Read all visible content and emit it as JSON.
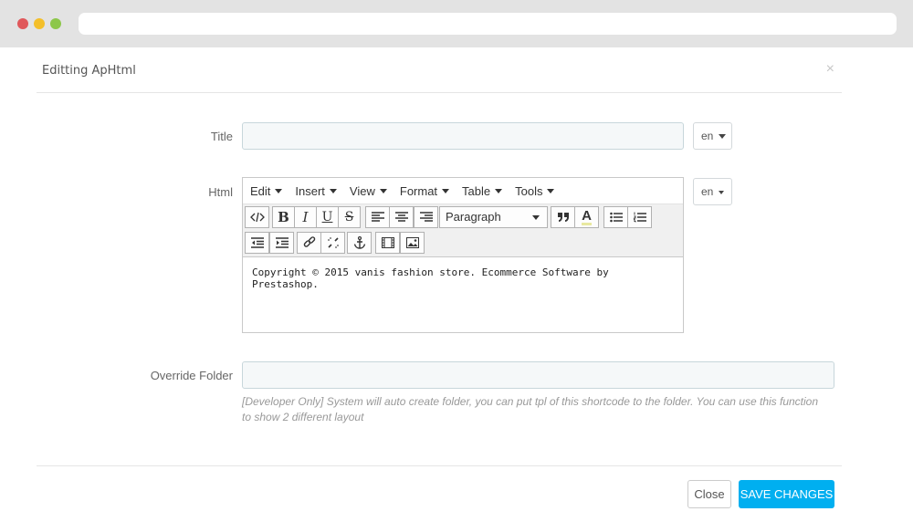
{
  "modal": {
    "title": "Editting ApHtml",
    "close_glyph": "×"
  },
  "form": {
    "title_label": "Title",
    "title_value": "",
    "title_lang": "en",
    "html_label": "Html",
    "html_lang": "en",
    "override_label": "Override Folder",
    "override_value": "",
    "override_help": "[Developer Only] System will auto create folder, you can put tpl of this shortcode to the folder. You can use this function to show 2 different layout"
  },
  "editor": {
    "menus": [
      {
        "label": "Edit"
      },
      {
        "label": "Insert"
      },
      {
        "label": "View"
      },
      {
        "label": "Format"
      },
      {
        "label": "Table"
      },
      {
        "label": "Tools"
      }
    ],
    "format_select": "Paragraph",
    "toolbar_icons": [
      "code-icon",
      "bold-icon",
      "italic-icon",
      "underline-icon",
      "strikethrough-icon",
      "align-left-icon",
      "align-center-icon",
      "align-right-icon",
      "blockquote-icon",
      "text-color-icon",
      "bullet-list-icon",
      "numbered-list-icon",
      "outdent-icon",
      "indent-icon",
      "link-icon",
      "unlink-icon",
      "anchor-icon",
      "media-icon",
      "image-icon"
    ],
    "content": "Copyright © 2015 vanis fashion store. Ecommerce Software by Prestashop."
  },
  "footer": {
    "close_label": "Close",
    "save_label": "SAVE CHANGES",
    "save_color": "#00aff0"
  }
}
